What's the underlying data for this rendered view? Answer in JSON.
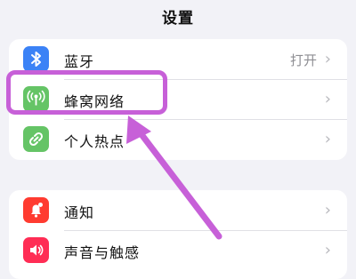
{
  "nav": {
    "title": "设置"
  },
  "group1": [
    {
      "label": "蓝牙",
      "value": "打开",
      "icon": "bluetooth-icon",
      "color": "#3b82f6"
    },
    {
      "label": "蜂窝网络",
      "value": "",
      "icon": "cellular-antenna-icon",
      "color": "#65c466"
    },
    {
      "label": "个人热点",
      "value": "",
      "icon": "personal-hotspot-icon",
      "color": "#65c466"
    }
  ],
  "group2": [
    {
      "label": "通知",
      "value": "",
      "icon": "notification-bell-icon",
      "color": "#ff3b30"
    },
    {
      "label": "声音与触感",
      "value": "",
      "icon": "speaker-icon",
      "color": "#ff2d55"
    }
  ],
  "chevron": "›",
  "annotation": {
    "highlight_color": "#c760d8",
    "highlighted_item": "蜂窝网络"
  }
}
